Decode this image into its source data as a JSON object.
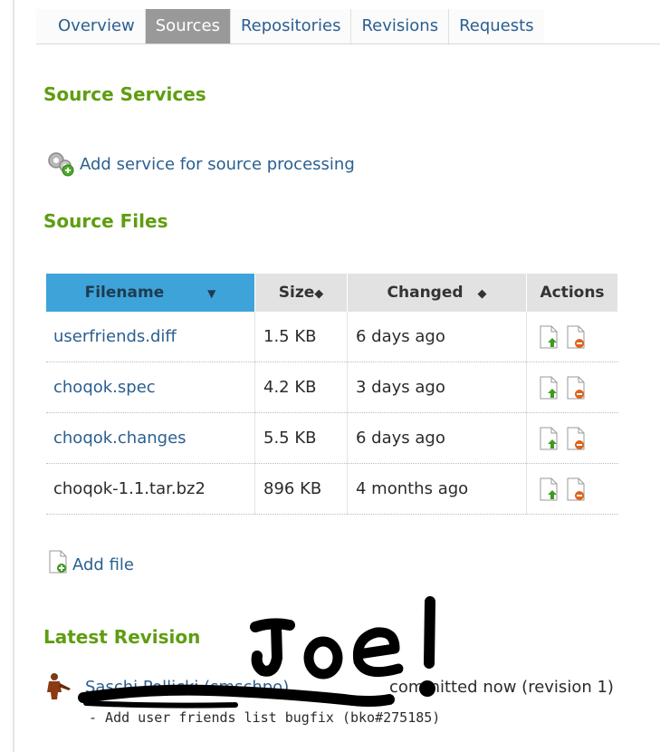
{
  "tabs": [
    {
      "label": "Overview"
    },
    {
      "label": "Sources"
    },
    {
      "label": "Repositories"
    },
    {
      "label": "Revisions"
    },
    {
      "label": "Requests"
    }
  ],
  "active_tab": "Sources",
  "services": {
    "title": "Source Services",
    "add_label": "Add service for source processing"
  },
  "files": {
    "title": "Source Files",
    "columns": {
      "filename": "Filename",
      "size": "Size",
      "changed": "Changed",
      "actions": "Actions"
    },
    "rows": [
      {
        "name": "userfriends.diff",
        "size": "1.5 KB",
        "changed": "6 days ago",
        "link": true
      },
      {
        "name": "choqok.spec",
        "size": "4.2 KB",
        "changed": "3 days ago",
        "link": true
      },
      {
        "name": "choqok.changes",
        "size": "5.5 KB",
        "changed": "6 days ago",
        "link": true
      },
      {
        "name": "choqok-1.1.tar.bz2",
        "size": "896 KB",
        "changed": "4 months ago",
        "link": false
      }
    ],
    "add_file_label": "Add file"
  },
  "revision": {
    "title": "Latest Revision",
    "author": "Saschi Pollicki (smschpo)",
    "committed": "committed now (revision 1)",
    "message": "- Add user friends list bugfix (bko#275185)"
  },
  "annotation": {
    "text": "Joe!",
    "color": "#000000"
  },
  "colors": {
    "accent_green": "#5f9d10",
    "link_blue": "#2a5f90",
    "sorted_header": "#3ea3d8",
    "active_tab": "#999999"
  }
}
